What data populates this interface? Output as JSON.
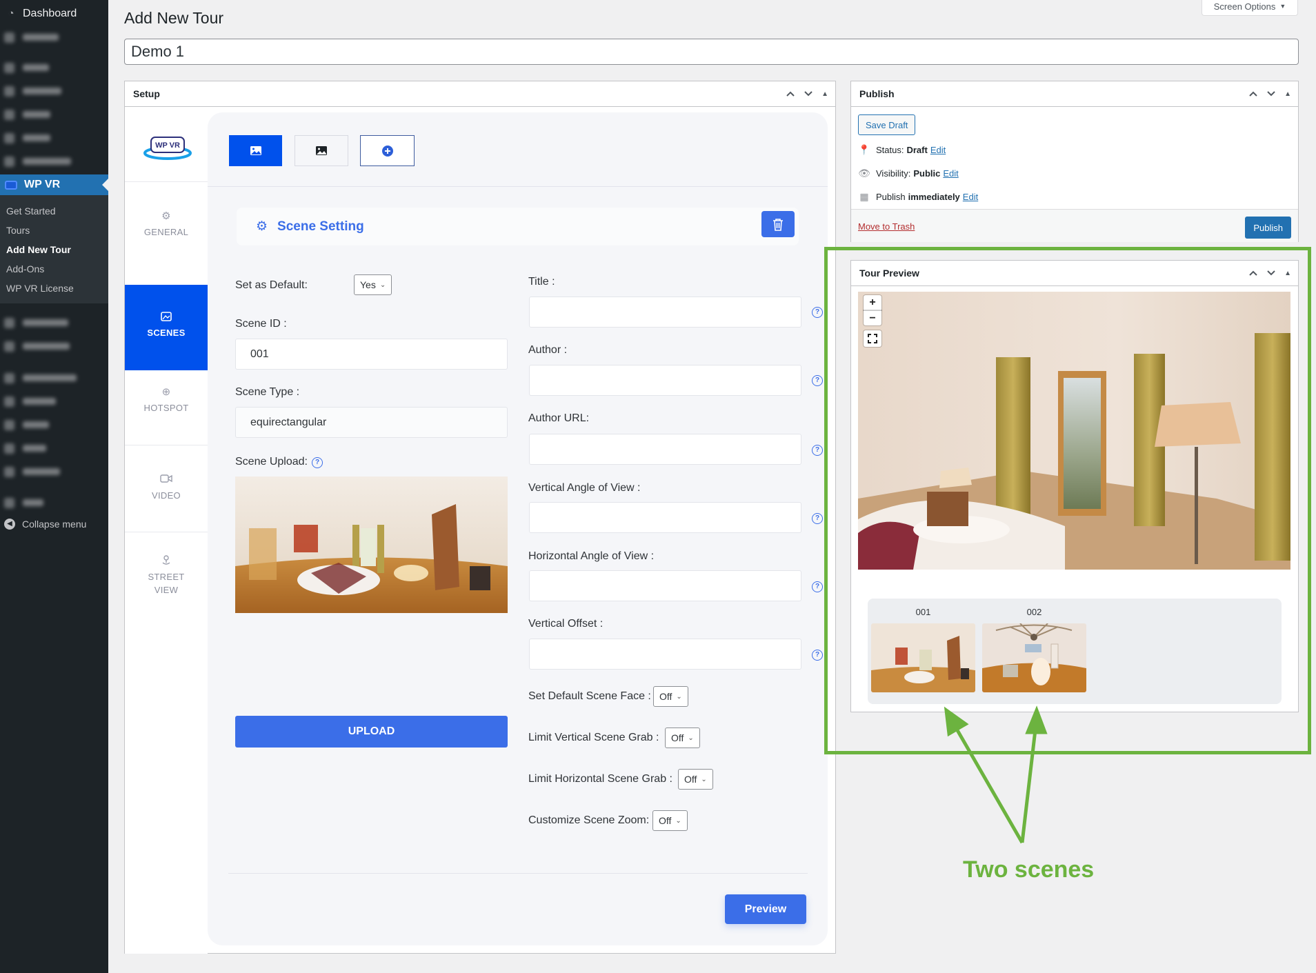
{
  "admin_menu": {
    "dashboard_label": "Dashboard",
    "active_plugin_label": "WP VR",
    "submenu": [
      {
        "label": "Get Started",
        "current": false
      },
      {
        "label": "Tours",
        "current": false
      },
      {
        "label": "Add New Tour",
        "current": true
      },
      {
        "label": "Add-Ons",
        "current": false
      },
      {
        "label": "WP VR License",
        "current": false
      }
    ],
    "collapse_label": "Collapse menu",
    "blurred_items_note": "other menu items are blurred/illegible"
  },
  "screen_options": {
    "label": "Screen Options",
    "caret": "▼"
  },
  "page": {
    "title": "Add New Tour",
    "tour_title_value": "Demo 1"
  },
  "setup_box": {
    "title": "Setup",
    "controls": {
      "up": "⌃",
      "down": "⌄",
      "toggle": "▲"
    },
    "logo_text": "WP VR",
    "nav_tabs": [
      {
        "label": "GENERAL",
        "icon": "gear-icon",
        "active": false
      },
      {
        "label": "SCENES",
        "icon": "image-icon",
        "active": true
      },
      {
        "label": "HOTSPOT",
        "icon": "crosshair-icon",
        "active": false
      },
      {
        "label": "VIDEO",
        "icon": "video-camera-icon",
        "active": false
      },
      {
        "label": "STREET VIEW",
        "icon": "map-pin-icon",
        "active": false
      }
    ],
    "scene_tabs": [
      {
        "name": "scene-1",
        "icon": "image-icon",
        "active": true
      },
      {
        "name": "scene-2",
        "icon": "image-icon",
        "active": false
      },
      {
        "name": "add-scene",
        "icon": "plus-circle-icon",
        "active": false
      }
    ],
    "scene_setting": {
      "heading": "Scene Setting",
      "set_as_default_label": "Set as Default:",
      "set_as_default_value": "Yes",
      "scene_id_label": "Scene ID :",
      "scene_id_value": "001",
      "scene_type_label": "Scene Type :",
      "scene_type_value": "equirectangular",
      "scene_upload_label": "Scene Upload:",
      "upload_button": "UPLOAD",
      "right_fields": [
        {
          "label": "Title :",
          "value": ""
        },
        {
          "label": "Author :",
          "value": ""
        },
        {
          "label": "Author URL:",
          "value": ""
        },
        {
          "label": "Vertical Angle of View :",
          "value": ""
        },
        {
          "label": "Horizontal Angle of View :",
          "value": ""
        },
        {
          "label": "Vertical Offset :",
          "value": ""
        }
      ],
      "toggles": [
        {
          "label": "Set Default Scene Face :",
          "value": "Off"
        },
        {
          "label": "Limit Vertical Scene Grab :",
          "value": "Off"
        },
        {
          "label": "Limit Horizontal Scene Grab :",
          "value": "Off"
        },
        {
          "label": "Customize Scene Zoom:",
          "value": "Off"
        }
      ]
    },
    "preview_button": "Preview"
  },
  "publish_box": {
    "title": "Publish",
    "save_draft": "Save Draft",
    "status_label": "Status:",
    "status_value": "Draft",
    "visibility_label": "Visibility:",
    "visibility_value": "Public",
    "publish_label": "Publish",
    "publish_when": "immediately",
    "edit_link": "Edit",
    "move_to_trash": "Move to Trash",
    "publish_button": "Publish"
  },
  "tour_preview": {
    "title": "Tour Preview",
    "zoom_in": "+",
    "zoom_out": "−",
    "scenes": [
      {
        "id": "001"
      },
      {
        "id": "002"
      }
    ]
  },
  "annotation": {
    "text": "Two scenes",
    "color": "#6cb33f"
  },
  "colors": {
    "wp_blue": "#2271b1",
    "wpvr_blue": "#0051ec",
    "accent_blue": "#3b6ee8",
    "admin_bg": "#1d2327"
  }
}
